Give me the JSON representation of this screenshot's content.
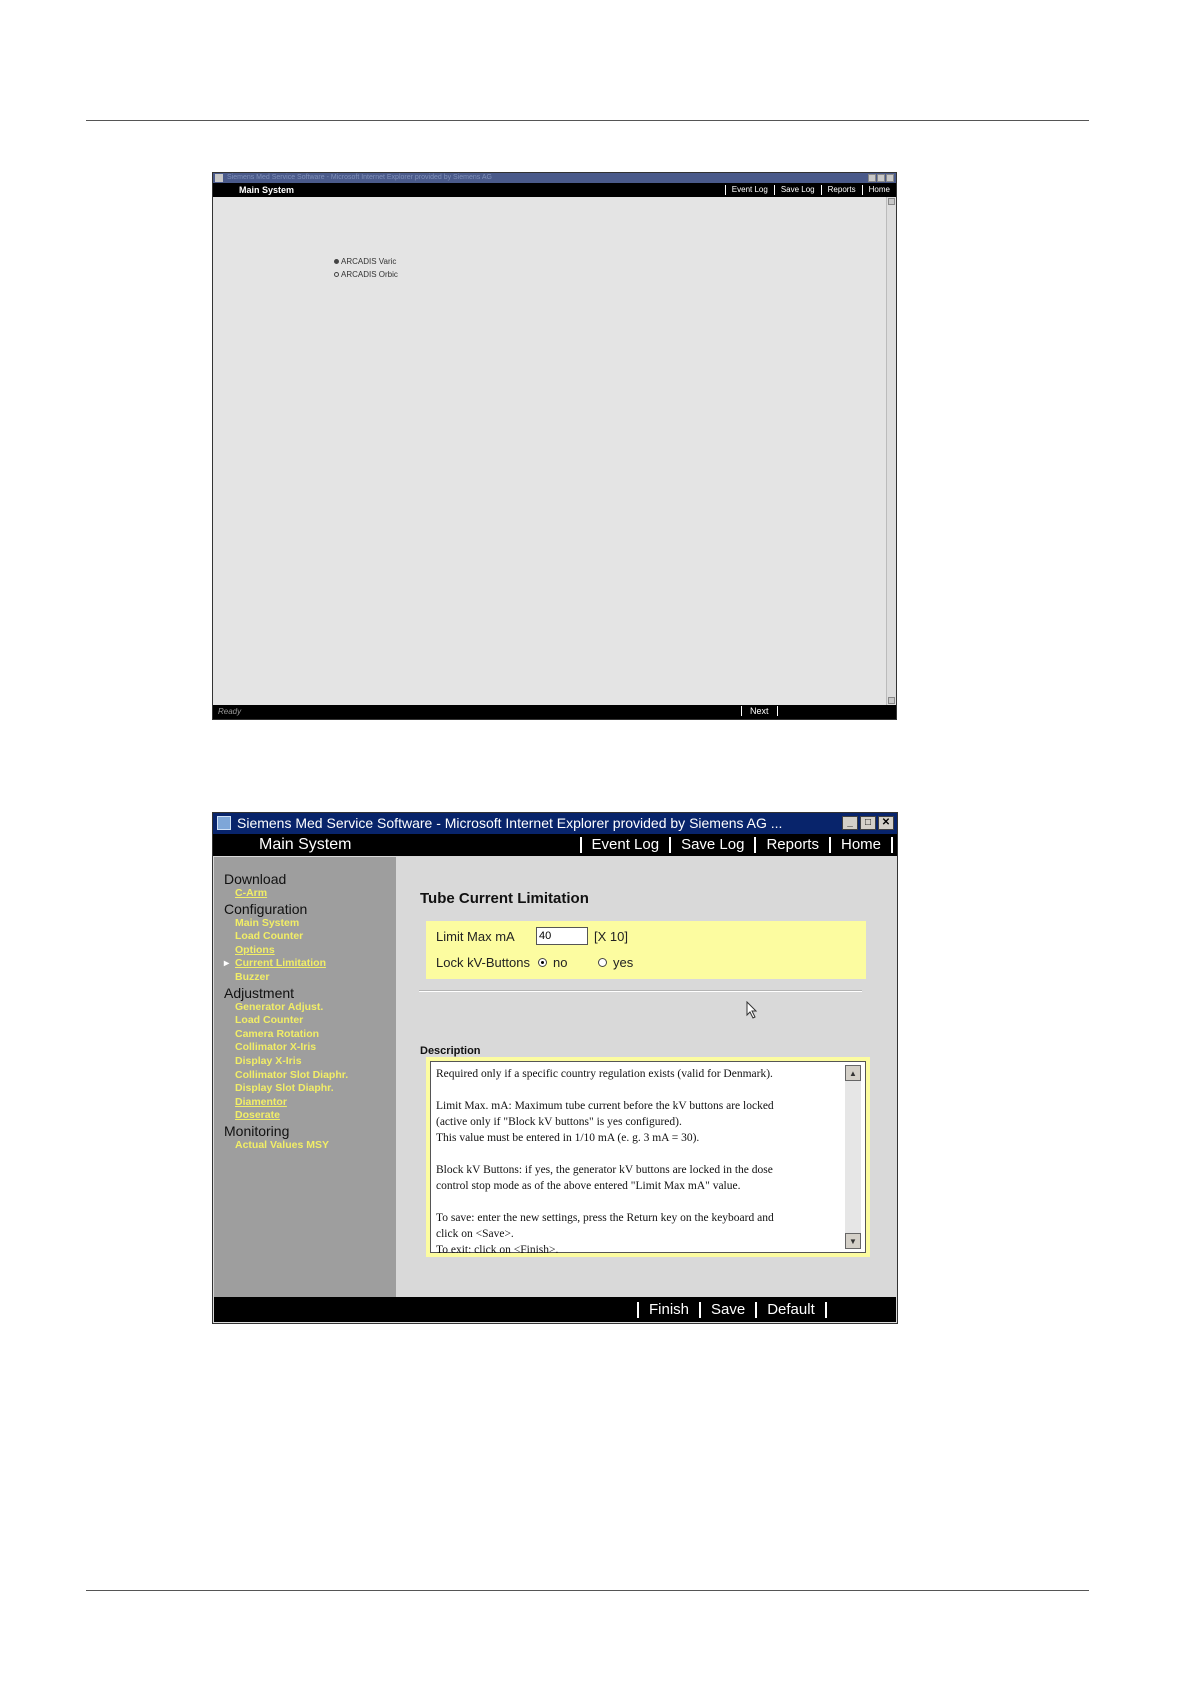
{
  "screen1": {
    "window_title": "Siemens Med Service Software - Microsoft Internet Explorer provided by Siemens AG",
    "app_title": "Main System",
    "nav_links": [
      "Event Log",
      "Save Log",
      "Reports",
      "Home"
    ],
    "options": [
      {
        "label": "ARCADIS Varic",
        "selected": true
      },
      {
        "label": "ARCADIS Orbic",
        "selected": false
      }
    ],
    "status_text": "Ready",
    "next_label": "Next"
  },
  "screen2": {
    "window_title": "Siemens Med Service Software - Microsoft Internet Explorer provided by Siemens AG ...",
    "app_title": "Main System",
    "nav_links": [
      "Event Log",
      "Save Log",
      "Reports",
      "Home"
    ],
    "sidebar": {
      "download": {
        "heading": "Download",
        "items": [
          "C-Arm"
        ]
      },
      "configuration": {
        "heading": "Configuration",
        "items": [
          "Main System",
          "Load Counter",
          "Options",
          "Current Limitation",
          "Buzzer"
        ]
      },
      "adjustment": {
        "heading": "Adjustment",
        "items": [
          "Generator Adjust.",
          "Load Counter",
          "Camera Rotation",
          "Collimator X-Iris",
          "Display X-Iris",
          "Collimator Slot Diaphr.",
          "Display Slot Diaphr.",
          "Diamentor",
          "Doserate"
        ]
      },
      "monitoring": {
        "heading": "Monitoring",
        "items": [
          "Actual Values MSY"
        ]
      }
    },
    "page_title": "Tube Current Limitation",
    "limit_label": "Limit Max mA",
    "limit_value": "40",
    "limit_unit": "[X 10]",
    "lock_label": "Lock kV-Buttons",
    "lock_options": {
      "no": "no",
      "yes": "yes",
      "selected": "no"
    },
    "description_title": "Description",
    "description_lines": [
      "Required only if a specific country regulation  exists (valid for Denmark).",
      "",
      "Limit Max. mA:  Maximum tube current before the kV buttons are locked",
      "(active only if \"Block kV buttons\" is yes configured).",
      "This value must be entered in 1/10 mA (e. g. 3 mA = 30).",
      "",
      "Block kV Buttons:  if yes, the generator kV buttons are locked in the dose",
      "control stop mode as of the above entered \"Limit Max mA\" value.",
      "",
      "To save: enter the new settings, press the Return key on the keyboard and",
      "click on <Save>.",
      "To exit: click on <Finish>."
    ],
    "footer_buttons": [
      "Finish",
      "Save",
      "Default"
    ]
  }
}
